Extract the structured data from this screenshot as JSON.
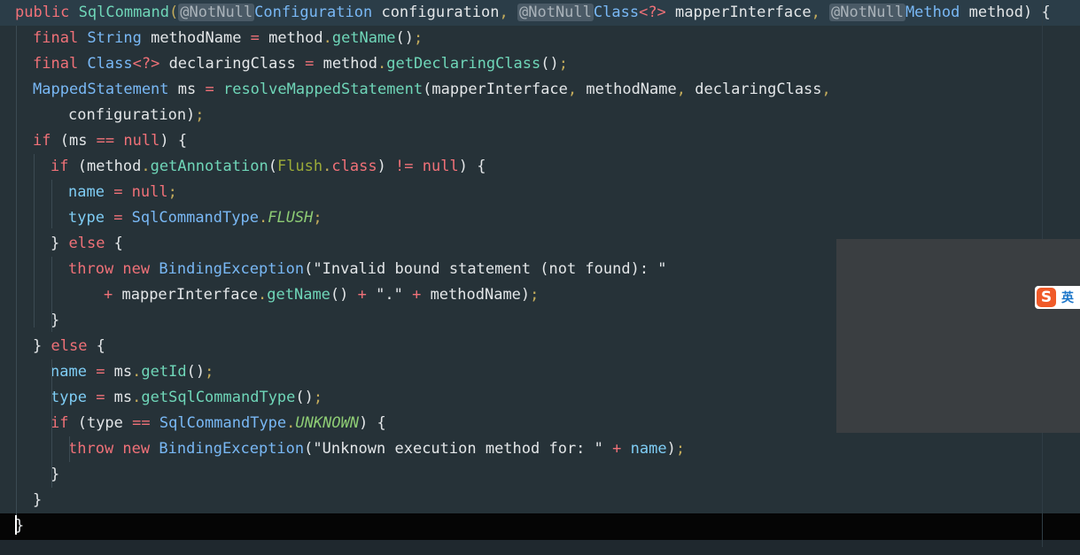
{
  "editor": {
    "lines": [
      [
        [
          "public ",
          "keyword"
        ],
        [
          "SqlCommand",
          "method"
        ],
        [
          "(",
          "punct"
        ],
        [
          "@NotNull",
          "annotation"
        ],
        [
          "Configuration",
          "type"
        ],
        [
          " configuration",
          "default"
        ],
        [
          ", ",
          "punct"
        ],
        [
          "@NotNull",
          "annotation"
        ],
        [
          "Class",
          "type"
        ],
        [
          "<?>",
          "generic"
        ],
        [
          " mapperInterface",
          "default"
        ],
        [
          ", ",
          "punct"
        ],
        [
          "@NotNull",
          "annotation"
        ],
        [
          "Method",
          "type"
        ],
        [
          " method) {",
          "default"
        ]
      ],
      [
        [
          "final ",
          "keyword"
        ],
        [
          "String",
          "type"
        ],
        [
          " methodName ",
          "default"
        ],
        [
          "= ",
          "op"
        ],
        [
          "method",
          "default"
        ],
        [
          ".",
          "punct"
        ],
        [
          "getName",
          "method"
        ],
        [
          "()",
          "default"
        ],
        [
          ";",
          "punct"
        ]
      ],
      [
        [
          "final ",
          "keyword"
        ],
        [
          "Class",
          "type"
        ],
        [
          "<?>",
          "generic"
        ],
        [
          " declaringClass ",
          "default"
        ],
        [
          "= ",
          "op"
        ],
        [
          "method",
          "default"
        ],
        [
          ".",
          "punct"
        ],
        [
          "getDeclaringClass",
          "method"
        ],
        [
          "()",
          "default"
        ],
        [
          ";",
          "punct"
        ]
      ],
      [
        [
          "MappedStatement",
          "type"
        ],
        [
          " ms ",
          "default"
        ],
        [
          "= ",
          "op"
        ],
        [
          "resolveMappedStatement",
          "method"
        ],
        [
          "(mapperInterface",
          "default"
        ],
        [
          ", ",
          "punct"
        ],
        [
          "methodName",
          "default"
        ],
        [
          ", ",
          "punct"
        ],
        [
          "declaringClass",
          "default"
        ],
        [
          ",",
          "punct"
        ]
      ],
      [
        [
          "configuration)",
          "default"
        ],
        [
          ";",
          "punct"
        ]
      ],
      [
        [
          "if ",
          "keyword"
        ],
        [
          "(ms ",
          "default"
        ],
        [
          "== ",
          "op"
        ],
        [
          "null",
          "keyword"
        ],
        [
          ") {",
          "default"
        ]
      ],
      [
        [
          "if ",
          "keyword"
        ],
        [
          "(method",
          "default"
        ],
        [
          ".",
          "punct"
        ],
        [
          "getAnnotation",
          "method"
        ],
        [
          "(",
          "default"
        ],
        [
          "Flush",
          "class"
        ],
        [
          ".",
          "punct"
        ],
        [
          "class",
          "keyword"
        ],
        [
          ") ",
          "default"
        ],
        [
          "!= ",
          "op"
        ],
        [
          "null",
          "keyword"
        ],
        [
          ") {",
          "default"
        ]
      ],
      [
        [
          "name ",
          "var"
        ],
        [
          "= ",
          "op"
        ],
        [
          "null",
          "keyword"
        ],
        [
          ";",
          "punct"
        ]
      ],
      [
        [
          "type ",
          "var"
        ],
        [
          "= ",
          "op"
        ],
        [
          "SqlCommandType",
          "type"
        ],
        [
          ".",
          "punct"
        ],
        [
          "FLUSH",
          "field"
        ],
        [
          ";",
          "punct"
        ]
      ],
      [
        [
          "} ",
          "default"
        ],
        [
          "else ",
          "keyword"
        ],
        [
          "{",
          "default"
        ]
      ],
      [
        [
          "throw ",
          "keyword"
        ],
        [
          "new ",
          "keyword"
        ],
        [
          "BindingException",
          "type"
        ],
        [
          "(\"Invalid bound statement (not found): \"",
          "string"
        ]
      ],
      [
        [
          "+ ",
          "op"
        ],
        [
          "mapperInterface",
          "default"
        ],
        [
          ".",
          "punct"
        ],
        [
          "getName",
          "method"
        ],
        [
          "() ",
          "default"
        ],
        [
          "+ ",
          "op"
        ],
        [
          "\".\" ",
          "string"
        ],
        [
          "+ ",
          "op"
        ],
        [
          "methodName)",
          "default"
        ],
        [
          ";",
          "punct"
        ]
      ],
      [
        [
          "}",
          "default"
        ]
      ],
      [
        [
          "} ",
          "default"
        ],
        [
          "else ",
          "keyword"
        ],
        [
          "{",
          "default"
        ]
      ],
      [
        [
          "name ",
          "var"
        ],
        [
          "= ",
          "op"
        ],
        [
          "ms",
          "default"
        ],
        [
          ".",
          "punct"
        ],
        [
          "getId",
          "method"
        ],
        [
          "()",
          "default"
        ],
        [
          ";",
          "punct"
        ]
      ],
      [
        [
          "type ",
          "var"
        ],
        [
          "= ",
          "op"
        ],
        [
          "ms",
          "default"
        ],
        [
          ".",
          "punct"
        ],
        [
          "getSqlCommandType",
          "method"
        ],
        [
          "()",
          "default"
        ],
        [
          ";",
          "punct"
        ]
      ],
      [
        [
          "if ",
          "keyword"
        ],
        [
          "(type ",
          "default"
        ],
        [
          "== ",
          "op"
        ],
        [
          "SqlCommandType",
          "type"
        ],
        [
          ".",
          "punct"
        ],
        [
          "UNKNOWN",
          "field"
        ],
        [
          ") {",
          "default"
        ]
      ],
      [
        [
          "throw ",
          "keyword"
        ],
        [
          "new ",
          "keyword"
        ],
        [
          "BindingException",
          "type"
        ],
        [
          "(\"Unknown execution method for: \" ",
          "string"
        ],
        [
          "+ ",
          "op"
        ],
        [
          "name",
          "var"
        ],
        [
          ")",
          "default"
        ],
        [
          ";",
          "punct"
        ]
      ],
      [
        [
          "}",
          "default"
        ]
      ],
      [
        [
          "}",
          "default"
        ]
      ],
      [
        [
          "}",
          "default"
        ]
      ]
    ]
  },
  "ime": {
    "logo_letter": "S",
    "language": "英"
  },
  "icons": {
    "ime": "sogou-ime-icon"
  }
}
